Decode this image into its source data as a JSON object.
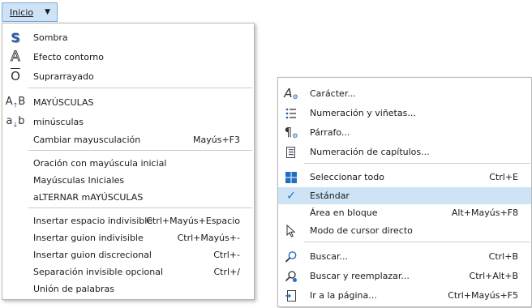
{
  "menu_button": {
    "label": "Inicio",
    "arrow": "▼"
  },
  "format_menu": {
    "items": [
      {
        "label": "Sombra",
        "shortcut": "",
        "icon": "shadow-icon"
      },
      {
        "label": "Efecto contorno",
        "shortcut": "",
        "icon": "outline-icon"
      },
      {
        "label": "Suprarrayado",
        "shortcut": "",
        "icon": "overline-icon"
      },
      {
        "label": "MAYÚSCULAS",
        "shortcut": "",
        "icon": "uppercase-icon"
      },
      {
        "label": "minúsculas",
        "shortcut": "",
        "icon": "lowercase-icon"
      },
      {
        "label": "Cambiar mayusculación",
        "shortcut": "Mayús+F3",
        "icon": ""
      },
      {
        "label": "Oración con mayúscula inicial",
        "shortcut": "",
        "icon": ""
      },
      {
        "label": "Mayúsculas Iniciales",
        "shortcut": "",
        "icon": ""
      },
      {
        "label": "aLTERNAR mAYÚSCULAS",
        "shortcut": "",
        "icon": ""
      },
      {
        "label": "Insertar espacio indivisible",
        "shortcut": "Ctrl+Mayús+Espacio",
        "icon": ""
      },
      {
        "label": "Insertar guion indivisible",
        "shortcut": "Ctrl+Mayús+-",
        "icon": ""
      },
      {
        "label": "Insertar guion discrecional",
        "shortcut": "Ctrl+-",
        "icon": ""
      },
      {
        "label": "Separación invisible opcional",
        "shortcut": "Ctrl+/",
        "icon": ""
      },
      {
        "label": "Unión de palabras",
        "shortcut": "",
        "icon": ""
      }
    ]
  },
  "context_menu": {
    "items": [
      {
        "label": "Carácter...",
        "shortcut": "",
        "icon": "character-icon"
      },
      {
        "label": "Numeración y viñetas...",
        "shortcut": "",
        "icon": "bullets-icon"
      },
      {
        "label": "Párrafo...",
        "shortcut": "",
        "icon": "paragraph-icon"
      },
      {
        "label": "Numeración de capítulos...",
        "shortcut": "",
        "icon": "chapter-numbering-icon"
      },
      {
        "label": "Seleccionar todo",
        "shortcut": "Ctrl+E",
        "icon": "select-all-icon"
      },
      {
        "label": "Estándar",
        "shortcut": "",
        "icon": "checkmark-icon"
      },
      {
        "label": "Área en bloque",
        "shortcut": "Alt+Mayús+F8",
        "icon": ""
      },
      {
        "label": "Modo de cursor directo",
        "shortcut": "",
        "icon": "cursor-icon"
      },
      {
        "label": "Buscar...",
        "shortcut": "Ctrl+B",
        "icon": "search-icon"
      },
      {
        "label": "Buscar y reemplazar...",
        "shortcut": "Ctrl+Alt+B",
        "icon": "find-replace-icon"
      },
      {
        "label": "Ir a la página...",
        "shortcut": "Ctrl+Mayús+F5",
        "icon": "goto-page-icon"
      }
    ]
  }
}
